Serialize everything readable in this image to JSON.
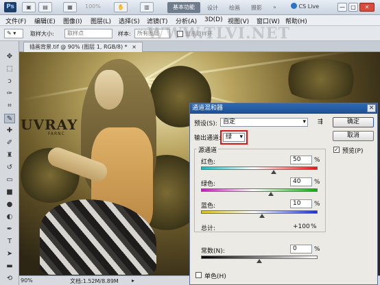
{
  "titlebar": {
    "logo": "Ps",
    "zoom": "100%",
    "workspaces": [
      "基本功能",
      "设计",
      "绘画",
      "摄影"
    ],
    "more": "»",
    "cs_live": "CS Live",
    "window_controls": [
      "—",
      "□",
      "✕"
    ]
  },
  "menu": [
    "文件(F)",
    "编辑(E)",
    "图像(I)",
    "图层(L)",
    "选择(S)",
    "滤镜(T)",
    "分析(A)",
    "3D(D)",
    "视图(V)",
    "窗口(W)",
    "帮助(H)"
  ],
  "options": {
    "sample_size_label": "取样大小:",
    "sample_size_value": "取样点",
    "sample_label": "样本:",
    "sample_value": "所有图层",
    "show_ring_label": "显示取样环"
  },
  "watermark": "WWW.TLVI.NET",
  "document": {
    "tab_title": "插画背景.tif @ 90% (图层 1, RGB/8) *",
    "tab_close": "×",
    "canvas_text": "UVRAY",
    "canvas_subtext": "FARNC"
  },
  "status": {
    "zoom": "90%",
    "doc_info": "文档:1.52M/8.89M"
  },
  "dialog": {
    "title": "通道混和器",
    "preset_label": "预设(S):",
    "preset_value": "自定",
    "output_label": "输出通道:",
    "output_value": "绿",
    "source_label": "源通道",
    "red_label": "红色:",
    "red_value": "50",
    "green_label": "绿色:",
    "green_value": "40",
    "blue_label": "蓝色:",
    "blue_value": "10",
    "total_label": "总计:",
    "total_value": "+100",
    "constant_label": "常数(N):",
    "constant_value": "0",
    "mono_label": "单色(H)",
    "ok_label": "确定",
    "cancel_label": "取消",
    "preview_label": "预览(P)",
    "preview_checked": "✓",
    "percent": "%",
    "close": "✕"
  },
  "sliders": {
    "red_fraction": 0.625,
    "green_fraction": 0.6,
    "blue_fraction": 0.525,
    "constant_fraction": 0.5
  },
  "colors": {
    "highlight": "#d11a1a",
    "title_blue": "#2f69b4"
  }
}
